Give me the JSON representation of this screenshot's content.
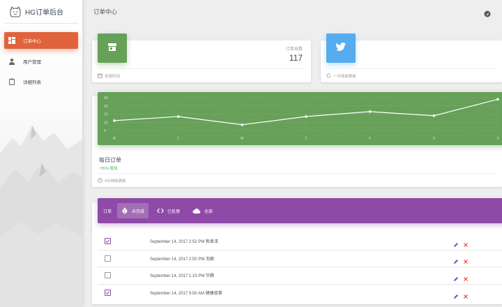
{
  "brand": {
    "title": "HG订单后台"
  },
  "sidebar": {
    "items": [
      {
        "label": "订单中心",
        "icon": "dashboard-icon",
        "active": true
      },
      {
        "label": "用户管理",
        "icon": "person-icon",
        "active": false
      },
      {
        "label": "详细列表",
        "icon": "clipboard-icon",
        "active": false
      }
    ]
  },
  "topbar": {
    "title": "订单中心"
  },
  "stats": [
    {
      "icon": "store-icon",
      "color": "#66a059",
      "label": "订单总数",
      "value": "117",
      "footer": "全部时间",
      "footer_icon": "calendar-icon"
    },
    {
      "icon": "twitter-icon",
      "color": "#55acee",
      "label": "",
      "value": "",
      "footer": "一分钟前更新",
      "footer_icon": "refresh-icon"
    }
  ],
  "chart_data": {
    "type": "line",
    "categories": [
      "M",
      "T",
      "W",
      "T",
      "F",
      "S",
      "S"
    ],
    "values": [
      12,
      17,
      7,
      17,
      23,
      18,
      38
    ],
    "yticks": [
      0,
      10,
      20,
      30,
      40
    ],
    "ylim": [
      0,
      40
    ],
    "title": "每日订单",
    "subtitle": "↑55% 增加",
    "footer": "4分钟前更新",
    "grid": true
  },
  "orders": {
    "label": "订单",
    "tabs": [
      {
        "label": "未完成",
        "icon": "bug-icon",
        "active": true
      },
      {
        "label": "已处理",
        "icon": "code-icon",
        "active": false
      },
      {
        "label": "全部",
        "icon": "cloud-icon",
        "active": false
      }
    ],
    "rows": [
      {
        "text": "September 14, 2017 2:52 PM 新鼻涕",
        "checked": true
      },
      {
        "text": "September 14, 2017 2:50 PM 泡面",
        "checked": false
      },
      {
        "text": "September 14, 2017 1:15 PM 华腾",
        "checked": false
      },
      {
        "text": "September 14, 2017 9:50 AM 健康故事",
        "checked": true
      }
    ]
  }
}
